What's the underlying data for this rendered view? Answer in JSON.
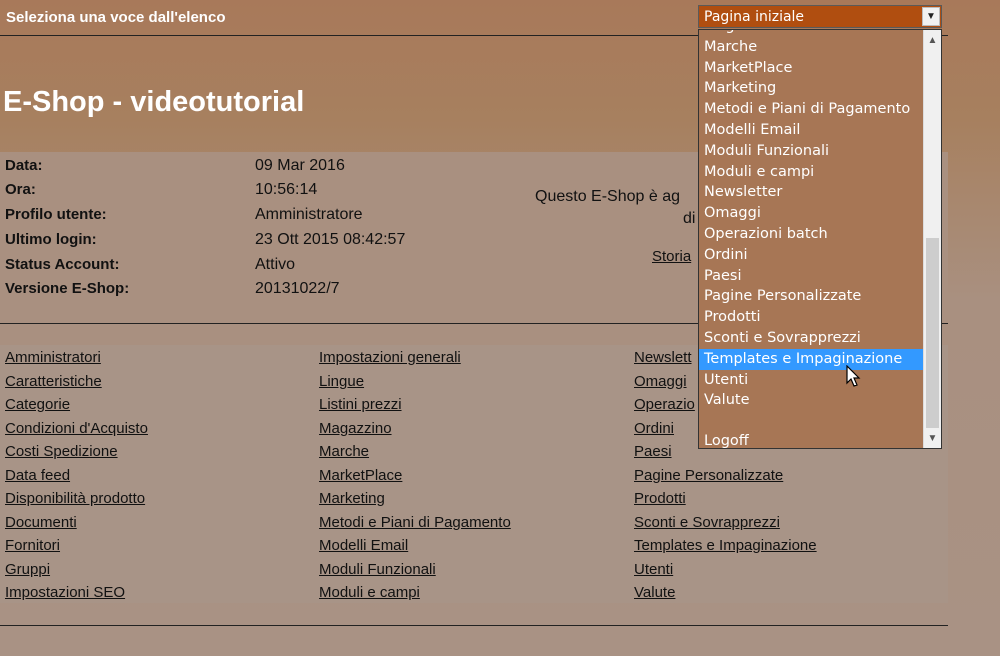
{
  "topbar": {
    "label": "Seleziona una voce dall'elenco",
    "select_value": "Pagina iniziale",
    "arrow": "▼"
  },
  "page_title": "E-Shop - videotutorial",
  "info": {
    "rows": [
      {
        "label": "Data:",
        "value": "09 Mar 2016"
      },
      {
        "label": "Ora:",
        "value": "10:56:14"
      },
      {
        "label": "Profilo utente:",
        "value": "Amministratore"
      },
      {
        "label": "Ultimo login:",
        "value": "23 Ott 2015 08:42:57"
      },
      {
        "label": "Status Account:",
        "value": "Attivo"
      },
      {
        "label": "Versione E-Shop:",
        "value": "20131022/7"
      }
    ],
    "right_text_1": "Questo E-Shop è ag",
    "right_text_2": "di",
    "right_link": "Storia"
  },
  "links": {
    "col1": [
      "Amministratori",
      "Caratteristiche",
      "Categorie",
      "Condizioni d'Acquisto",
      "Costi Spedizione",
      "Data feed",
      "Disponibilità prodotto",
      "Documenti",
      "Fornitori",
      "Gruppi",
      "Impostazioni SEO"
    ],
    "col2": [
      "Impostazioni generali",
      "Lingue",
      "Listini prezzi",
      "Magazzino",
      "Marche",
      "MarketPlace",
      "Marketing",
      "Metodi e Piani di Pagamento",
      "Modelli Email",
      "Moduli Funzionali",
      "Moduli e campi"
    ],
    "col3": [
      "Newslett",
      "Omaggi",
      "Operazio",
      "Ordini",
      "Paesi",
      "Pagine Personalizzate",
      "Prodotti",
      "Sconti e Sovrapprezzi",
      "Templates e Impaginazione",
      "Utenti",
      "Valute"
    ]
  },
  "dropdown": {
    "items": [
      "Magazzino",
      "Marche",
      "MarketPlace",
      "Marketing",
      "Metodi e Piani di Pagamento",
      "Modelli Email",
      "Moduli Funzionali",
      "Moduli e campi",
      "Newsletter",
      "Omaggi",
      "Operazioni batch",
      "Ordini",
      "Paesi",
      "Pagine Personalizzate",
      "Prodotti",
      "Sconti e Sovrapprezzi",
      "Templates e Impaginazione",
      "Utenti",
      "Valute",
      "",
      "Logoff"
    ],
    "selected_index": 16,
    "scroll_up": "▲",
    "scroll_down": "▼"
  }
}
